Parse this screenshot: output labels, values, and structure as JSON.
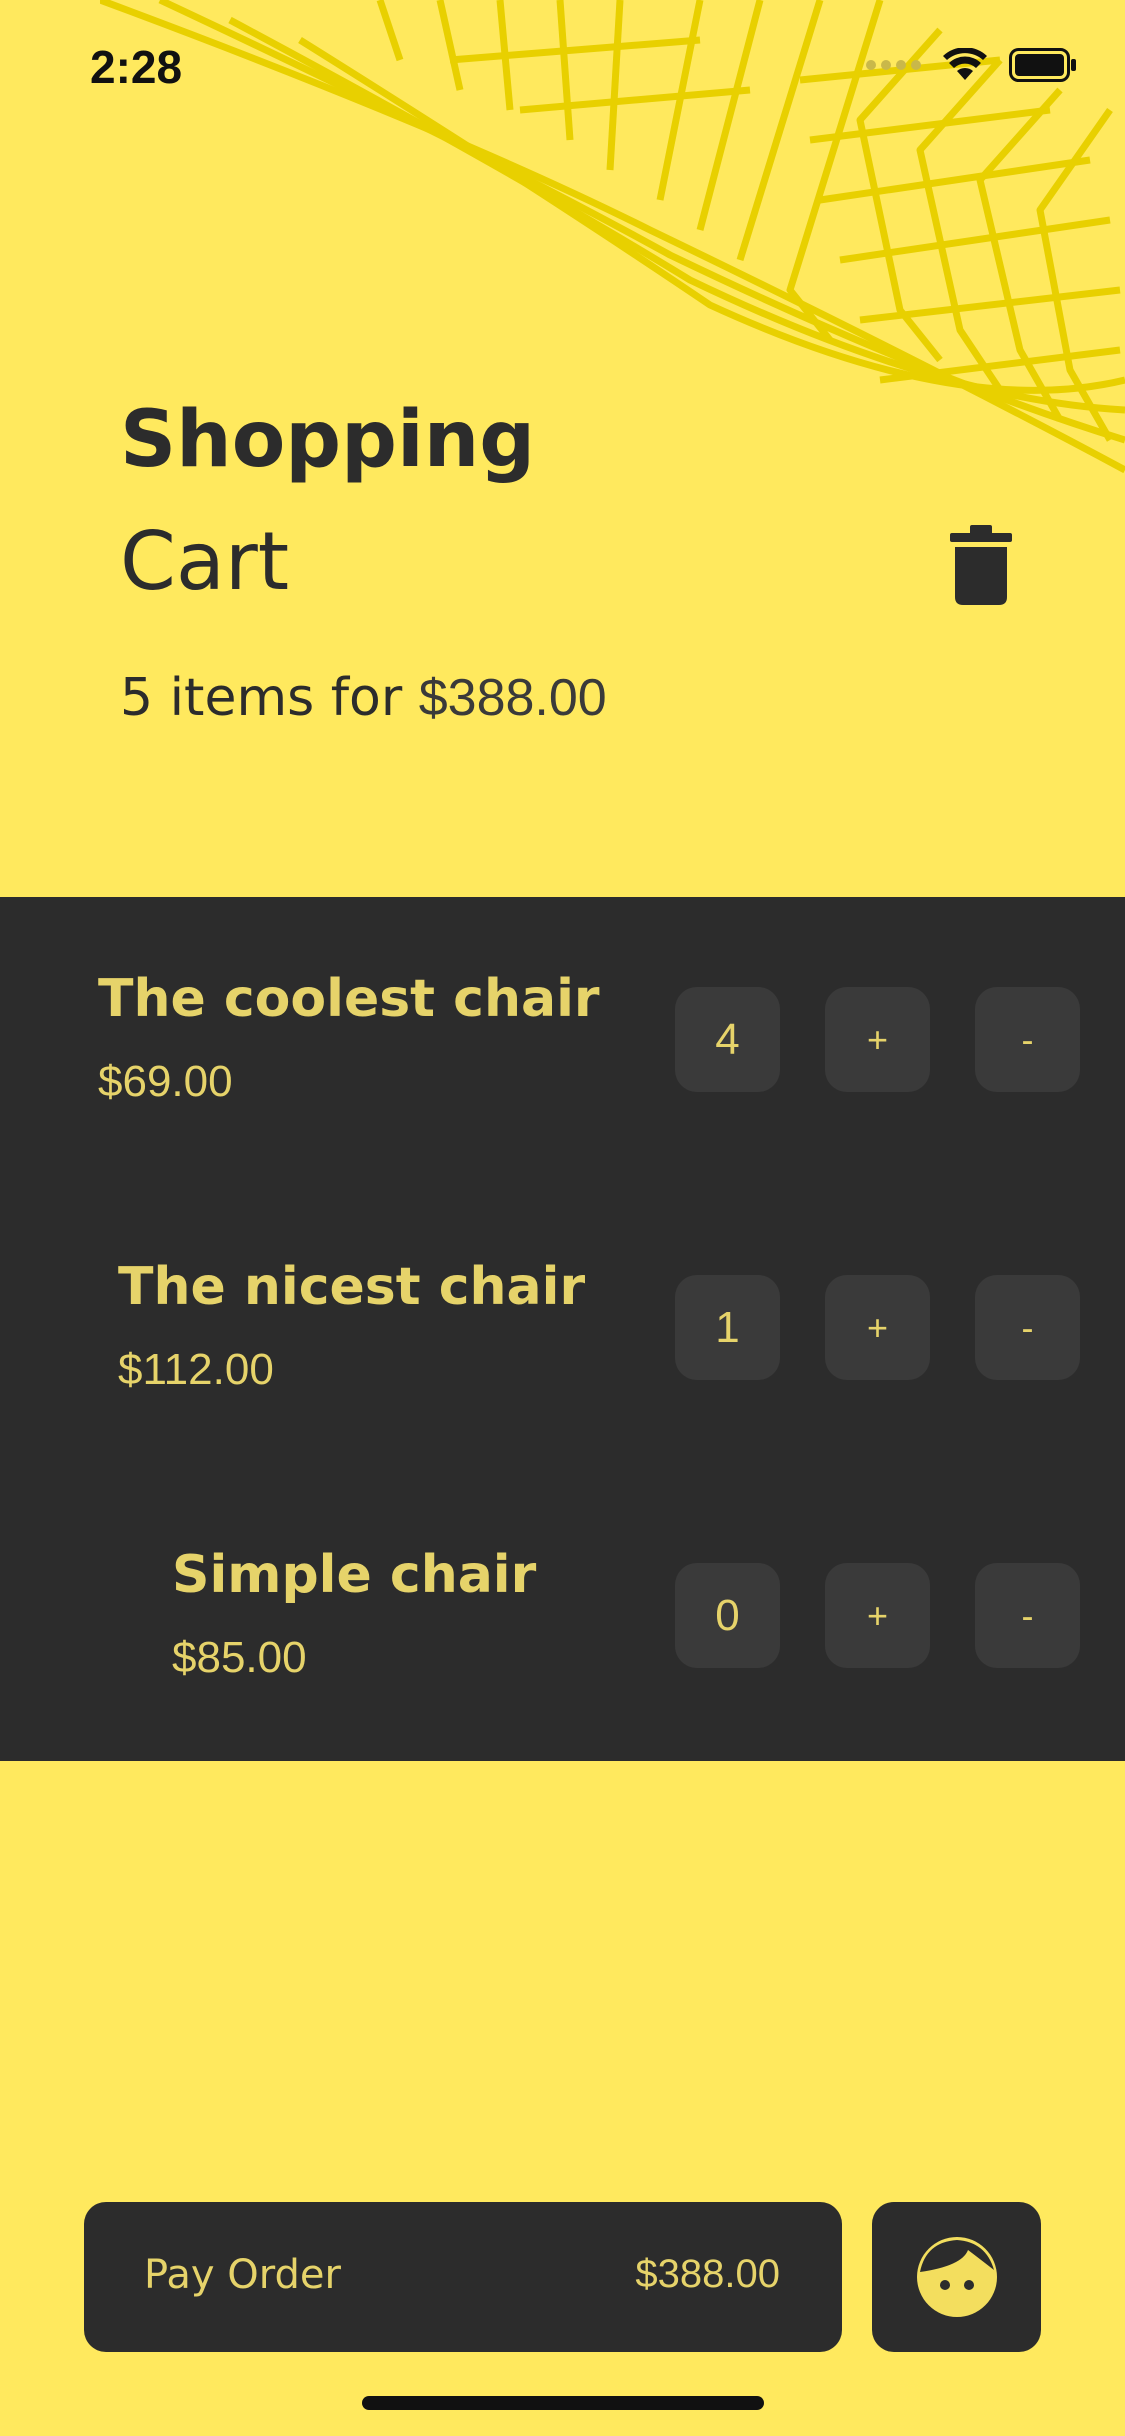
{
  "status_bar": {
    "time": "2:28",
    "icons": [
      "cellular-icon",
      "wifi-icon",
      "battery-icon"
    ]
  },
  "header": {
    "title_bold": "Shopping",
    "title_light": "Cart",
    "summary_count": "5 items for",
    "summary_total": "$388.00",
    "trash_icon": "trash-icon"
  },
  "cart": {
    "items": [
      {
        "name": "The coolest chair",
        "price": "$69.00",
        "quantity": "4",
        "plus_label": "+",
        "minus_label": "-"
      },
      {
        "name": "The nicest chair",
        "price": "$112.00",
        "quantity": "1",
        "plus_label": "+",
        "minus_label": "-"
      },
      {
        "name": "Simple chair",
        "price": "$85.00",
        "quantity": "0",
        "plus_label": "+",
        "minus_label": "-"
      }
    ]
  },
  "footer": {
    "pay_label": "Pay Order",
    "pay_amount": "$388.00",
    "profile_icon": "face-icon"
  },
  "colors": {
    "background": "#FFE95E",
    "dark": "#2C2C2C",
    "accent_text": "#E6D36A",
    "button_fill": "#3A3A3A"
  }
}
